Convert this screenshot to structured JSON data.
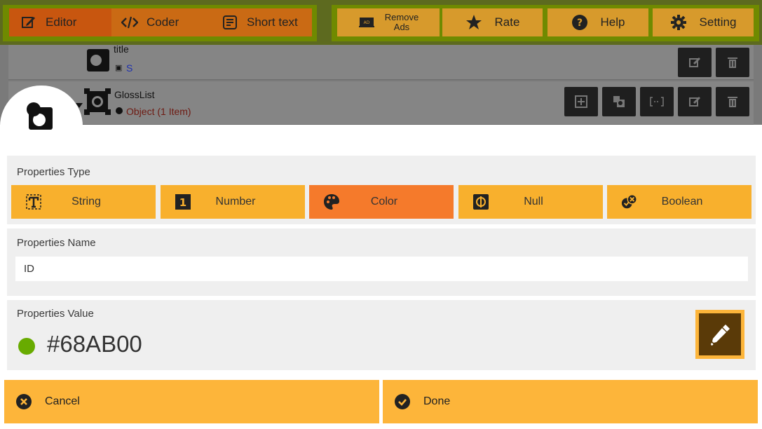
{
  "toolbar": {
    "tabs": [
      {
        "label": "Editor",
        "icon": "edit-icon"
      },
      {
        "label": "Coder",
        "icon": "code-icon"
      },
      {
        "label": "Short text",
        "icon": "text-doc-icon"
      }
    ],
    "actions": [
      {
        "label": "Remove\nAds",
        "icon": "ad-icon"
      },
      {
        "label": "Rate",
        "icon": "star-icon"
      },
      {
        "label": "Help",
        "icon": "help-icon"
      },
      {
        "label": "Setting",
        "icon": "gear-icon"
      }
    ]
  },
  "tree": {
    "row1": {
      "name": "title",
      "sub": "S"
    },
    "row2": {
      "name": "GlossList",
      "sub": "Object (1 Item)"
    }
  },
  "dialog": {
    "type_label": "Properties Type",
    "types": [
      {
        "label": "String",
        "icon": "string-type-icon"
      },
      {
        "label": "Number",
        "icon": "number-type-icon"
      },
      {
        "label": "Color",
        "icon": "palette-icon"
      },
      {
        "label": "Null",
        "icon": "null-type-icon"
      },
      {
        "label": "Boolean",
        "icon": "boolean-type-icon"
      }
    ],
    "selected_type": "Color",
    "name_label": "Properties Name",
    "name_value": "ID",
    "value_label": "Properties Value",
    "color_value": "#68AB00",
    "cancel_label": "Cancel",
    "done_label": "Done"
  },
  "colors": {
    "accent": "#f8b02d",
    "selected": "#f57a2b",
    "value_swatch": "#68AB00"
  }
}
